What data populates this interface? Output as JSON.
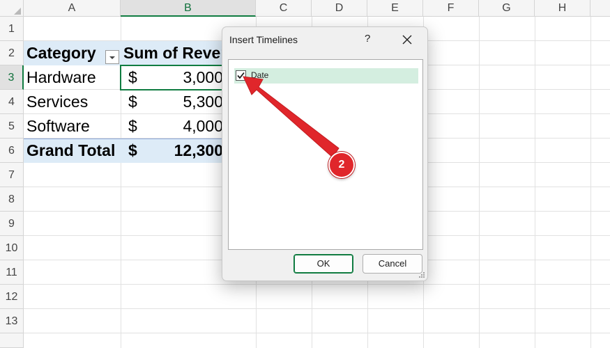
{
  "columns": [
    "A",
    "B",
    "C",
    "D",
    "E",
    "F",
    "G",
    "H"
  ],
  "active_column": "B",
  "rows": [
    "1",
    "2",
    "3",
    "4",
    "5",
    "6",
    "7",
    "8",
    "9",
    "10",
    "11",
    "12",
    "13"
  ],
  "active_row": "3",
  "pivot": {
    "header": {
      "category": "Category",
      "sum": "Sum of Reven"
    },
    "rows": [
      {
        "category": "Hardware",
        "currency": "$",
        "value": "3,000"
      },
      {
        "category": "Services",
        "currency": "$",
        "value": "5,300"
      },
      {
        "category": "Software",
        "currency": "$",
        "value": "4,000"
      }
    ],
    "total": {
      "label": "Grand Total",
      "currency": "$",
      "value": "12,300"
    }
  },
  "dialog": {
    "title": "Insert Timelines",
    "help": "?",
    "items": [
      {
        "label": "Date",
        "checked": true
      }
    ],
    "ok_label": "OK",
    "cancel_label": "Cancel"
  },
  "annotation": {
    "step": "2",
    "color": "#e0262b"
  },
  "colors": {
    "accent": "#107c41",
    "pivot_band": "#ddebf7",
    "list_selection": "#d4eee0"
  }
}
